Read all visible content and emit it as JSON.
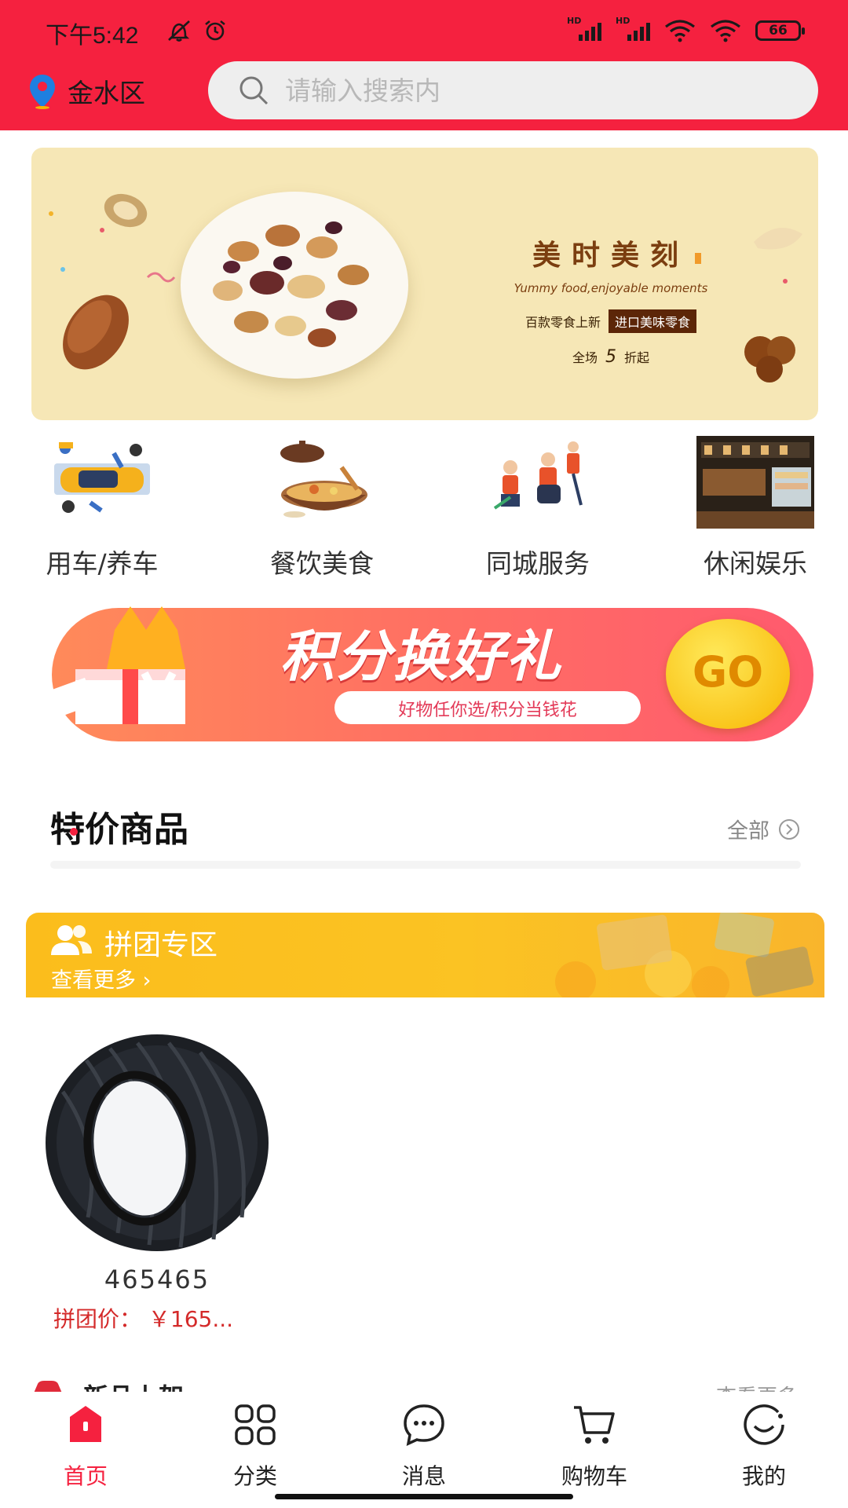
{
  "status_bar": {
    "time": "下午5:42",
    "battery": "66",
    "signal_label": "HD"
  },
  "header": {
    "location": "金水区",
    "search_placeholder": "请输入搜索内"
  },
  "banner": {
    "title": "美时美刻",
    "subtitle": "Yummy food,enjoyable moments",
    "line1_prefix": "百款零食上新",
    "line1_tag": "进口美味零食",
    "discount_prefix": "全场",
    "discount_value": "5",
    "discount_suffix": "折起"
  },
  "categories": [
    {
      "label": "用车/养车",
      "icon": "car-care-icon"
    },
    {
      "label": "餐饮美食",
      "icon": "food-pot-icon"
    },
    {
      "label": "同城服务",
      "icon": "city-service-icon"
    },
    {
      "label": "休闲娱乐",
      "icon": "leisure-photo-icon"
    }
  ],
  "points_banner": {
    "title": "积分换好礼",
    "subtitle": "好物任你选/积分当钱花",
    "go": "GO"
  },
  "specials": {
    "title": "特价商品",
    "view_all": "全部"
  },
  "group_buy": {
    "title": "拼团专区",
    "more": "查看更多"
  },
  "product": {
    "name": "465465",
    "price": "拼团价： ￥165..."
  },
  "new_arrivals": {
    "title": "新品上架",
    "more": "查看更多"
  },
  "tabs": [
    {
      "label": "首页",
      "icon": "home-icon",
      "active": true
    },
    {
      "label": "分类",
      "icon": "grid-icon",
      "active": false
    },
    {
      "label": "消息",
      "icon": "message-icon",
      "active": false
    },
    {
      "label": "购物车",
      "icon": "cart-icon",
      "active": false
    },
    {
      "label": "我的",
      "icon": "profile-icon",
      "active": false
    }
  ],
  "colors": {
    "primary": "#f5213f",
    "group_bar": "#fbbd1c",
    "price": "#d42a2a"
  }
}
